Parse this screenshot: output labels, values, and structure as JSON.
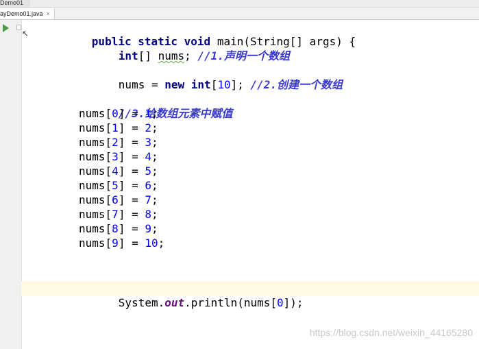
{
  "breadcrumb": "Demo01",
  "tab": {
    "label": "ayDemo01.java",
    "close": "×"
  },
  "code": {
    "l1": {
      "kw": "public static void",
      "rest": " main(String[] args) {"
    },
    "l2": {
      "kw": "int",
      "mid": "[] ",
      "var": "nums",
      "semi": "; ",
      "comment": "//1.声明一个数组"
    },
    "l3": {
      "pre": "nums = ",
      "kw1": "new",
      "sp": " ",
      "kw2": "int",
      "lb": "[",
      "num": "10",
      "rb": "]; ",
      "comment": "//2.创建一个数组"
    },
    "l4": {
      "comment": "//3.给数组元素中赋值"
    },
    "assignments": [
      {
        "idx": "0",
        "val": "1"
      },
      {
        "idx": "1",
        "val": "2"
      },
      {
        "idx": "2",
        "val": "3"
      },
      {
        "idx": "3",
        "val": "4"
      },
      {
        "idx": "4",
        "val": "5"
      },
      {
        "idx": "5",
        "val": "6"
      },
      {
        "idx": "6",
        "val": "7"
      },
      {
        "idx": "7",
        "val": "8"
      },
      {
        "idx": "8",
        "val": "9"
      },
      {
        "idx": "9",
        "val": "10"
      }
    ],
    "print": {
      "pre": "System.",
      "field": "out",
      "mid": ".println(nums[",
      "num": "0",
      "post": "]);"
    }
  },
  "watermark": "https://blog.csdn.net/weixin_44165280"
}
